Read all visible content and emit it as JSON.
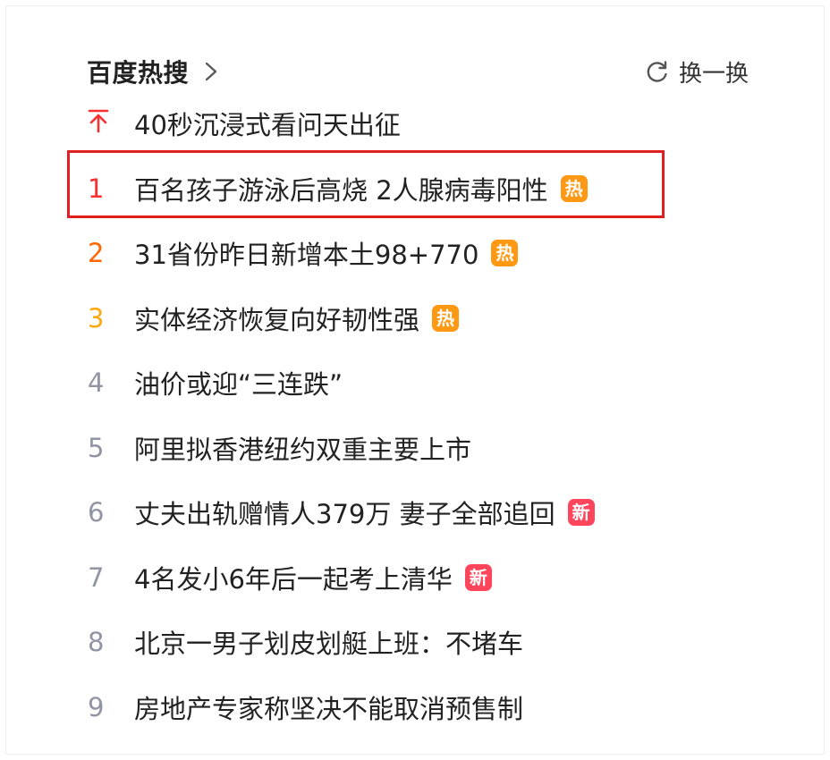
{
  "header": {
    "title": "百度热搜",
    "refresh_label": "换一换"
  },
  "icons": {
    "chevron": "chevron-right-icon",
    "refresh": "refresh-icon",
    "top": "arrow-to-top-icon"
  },
  "colors": {
    "rank1": "#f73131",
    "rank2": "#ff6600",
    "rank3": "#faa90e",
    "rank_default": "#9195a3",
    "hot_tag": "#ff9812",
    "new_tag": "#ff455b",
    "highlight_border": "#e02020"
  },
  "items": [
    {
      "rank": "",
      "text": "40秒沉浸式看问天出征",
      "tag": ""
    },
    {
      "rank": "1",
      "text": "百名孩子游泳后高烧 2人腺病毒阳性",
      "tag": "热"
    },
    {
      "rank": "2",
      "text": "31省份昨日新增本土98+770",
      "tag": "热"
    },
    {
      "rank": "3",
      "text": "实体经济恢复向好韧性强",
      "tag": "热"
    },
    {
      "rank": "4",
      "text": "油价或迎“三连跌”",
      "tag": ""
    },
    {
      "rank": "5",
      "text": "阿里拟香港纽约双重主要上市",
      "tag": ""
    },
    {
      "rank": "6",
      "text": "丈夫出轨赠情人379万 妻子全部追回",
      "tag": "新"
    },
    {
      "rank": "7",
      "text": "4名发小6年后一起考上清华",
      "tag": "新"
    },
    {
      "rank": "8",
      "text": "北京一男子划皮划艇上班：不堵车",
      "tag": ""
    },
    {
      "rank": "9",
      "text": "房地产专家称坚决不能取消预售制",
      "tag": ""
    }
  ]
}
